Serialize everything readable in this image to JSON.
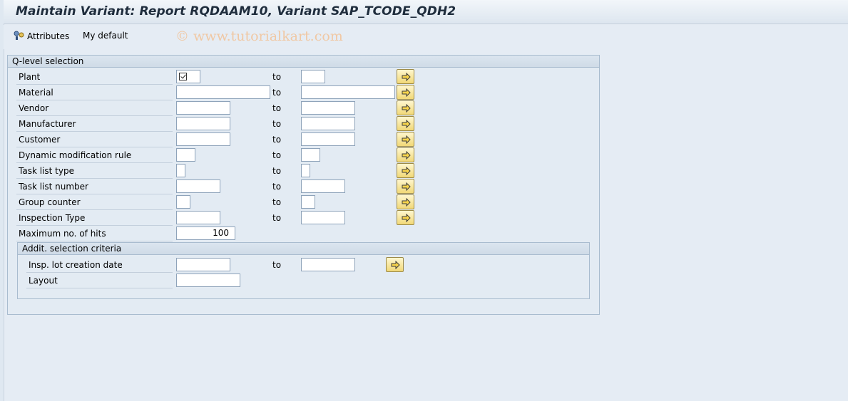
{
  "window": {
    "title": "Maintain Variant: Report RQDAAM10, Variant SAP_TCODE_QDH2"
  },
  "toolbar": {
    "attributes_label": "Attributes",
    "my_default_label": "My default"
  },
  "watermark": "© www.tutorialkart.com",
  "qlevel_group": {
    "title": "Q-level selection",
    "to_label": "to",
    "rows": [
      {
        "label": "Plant",
        "from_value": "",
        "to_value": ""
      },
      {
        "label": "Material",
        "from_value": "",
        "to_value": ""
      },
      {
        "label": "Vendor",
        "from_value": "",
        "to_value": ""
      },
      {
        "label": "Manufacturer",
        "from_value": "",
        "to_value": ""
      },
      {
        "label": "Customer",
        "from_value": "",
        "to_value": ""
      },
      {
        "label": "Dynamic modification rule",
        "from_value": "",
        "to_value": ""
      },
      {
        "label": "Task list type",
        "from_value": "",
        "to_value": ""
      },
      {
        "label": "Task list number",
        "from_value": "",
        "to_value": ""
      },
      {
        "label": "Group counter",
        "from_value": "",
        "to_value": ""
      },
      {
        "label": "Inspection Type",
        "from_value": "",
        "to_value": ""
      }
    ],
    "max_hits": {
      "label": "Maximum no. of hits",
      "value": "100"
    }
  },
  "additional_group": {
    "title": "Addit. selection criteria",
    "to_label": "to",
    "rows": [
      {
        "label": "Insp. lot creation date",
        "from_value": "",
        "to_value": ""
      },
      {
        "label": "Layout",
        "value": ""
      }
    ]
  },
  "icons": {
    "attributes": "attributes-icon",
    "multiple_selection": "multiple-selection-arrow-icon",
    "checkbox": "checkbox-icon"
  }
}
